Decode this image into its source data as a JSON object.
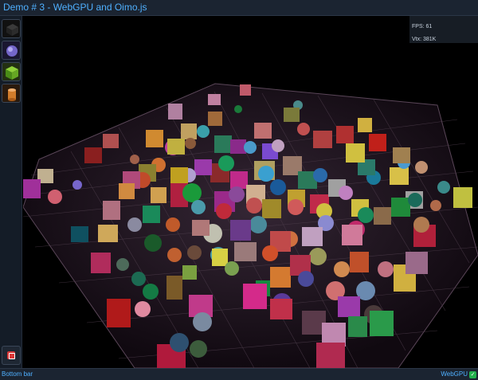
{
  "title": "Demo # 3 - WebGPU and Oimo.js",
  "sidebar": {
    "tools": [
      {
        "name": "cube-dark-icon"
      },
      {
        "name": "sphere-icon"
      },
      {
        "name": "cube-green-icon"
      },
      {
        "name": "cylinder-icon"
      }
    ],
    "bottom_button_icon": "stop-icon"
  },
  "stats": {
    "fps": "FPS: 61",
    "vtx": "Vtx: 381K"
  },
  "bottom_bar": {
    "left": "Bottom bar",
    "right": "WebGPU",
    "check_symbol": "✓"
  },
  "colors": {
    "bar_bg": "#1b2431",
    "accent_text": "#4fb0ff",
    "grid": "#5a4658"
  }
}
